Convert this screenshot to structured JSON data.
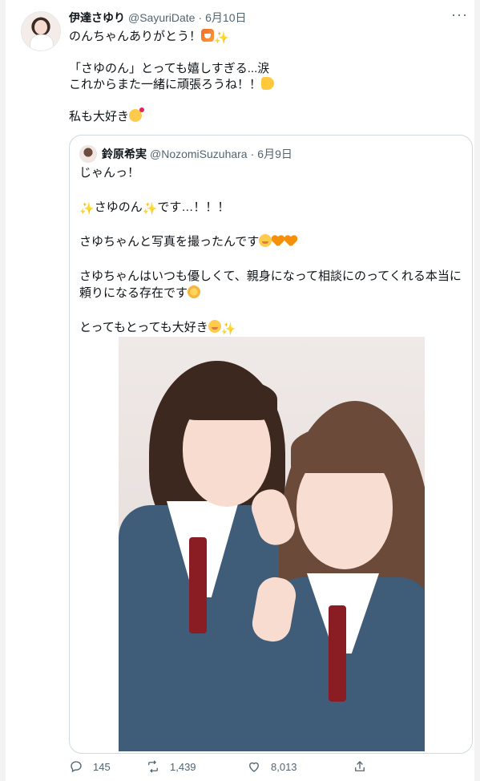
{
  "tweet": {
    "author_name": "伊達さゆり",
    "author_handle": "@SayuriDate",
    "separator": "·",
    "date": "6月10日",
    "more_label": "···",
    "lines": [
      "のんちゃんありがとう！",
      "「さゆのん」とっても嬉しすぎる...涙",
      "これからまた一緒に頑張ろうね！！",
      "私も大好き"
    ]
  },
  "quote": {
    "author_name": "鈴原希実",
    "author_handle": "@NozomiSuzuhara",
    "separator": "·",
    "date": "6月9日",
    "lines": [
      "じゃんっ！",
      "さゆのん",
      "です…！！！",
      "さゆちゃんと写真を撮ったんです",
      "さゆちゃんはいつも優しくて、親身になって相談にのってくれる本当に",
      "頼りになる存在です",
      "とってもとっても大好き"
    ]
  },
  "actions": {
    "reply_count": "145",
    "retweet_count": "1,439",
    "like_count": "8,013"
  },
  "icons": {
    "reply": "reply-icon",
    "retweet": "retweet-icon",
    "like": "heart-icon",
    "share": "share-icon"
  },
  "colors": {
    "text_primary": "#0f1419",
    "text_secondary": "#536471",
    "border": "#cfd9de",
    "gutter": "#f3f3f3"
  }
}
